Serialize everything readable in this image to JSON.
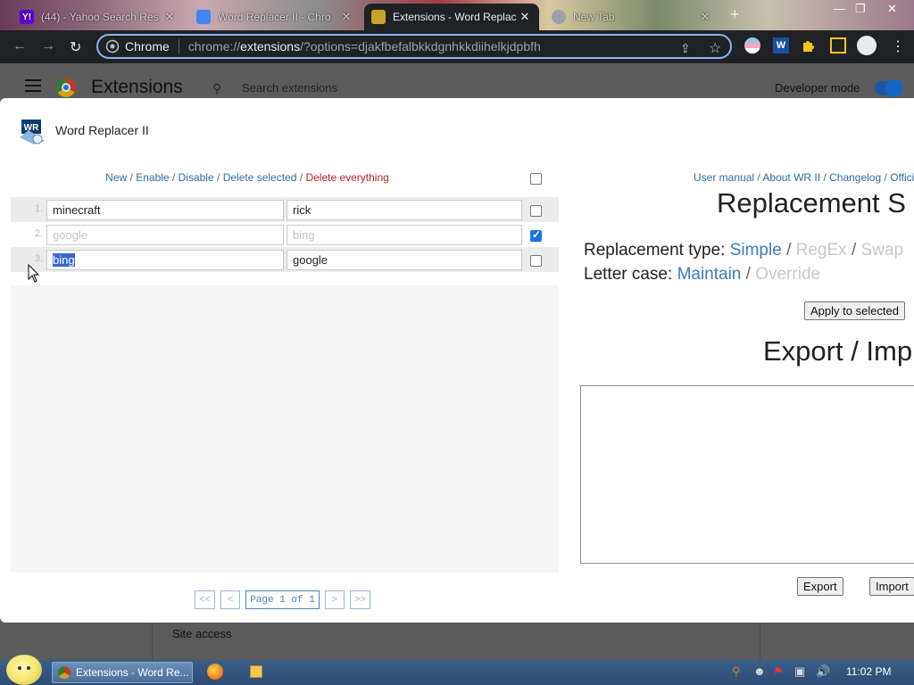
{
  "browser": {
    "tabs": [
      {
        "label": "(44) - Yahoo Search Res",
        "close": "✕",
        "favicon": "Y!",
        "favicon_color": "#6001d2"
      },
      {
        "label": "Word Replacer II - Chro",
        "close": "✕",
        "favicon_color": "#4285f4"
      },
      {
        "label": "Extensions - Word Replac",
        "close": "✕",
        "favicon_color": "#c9a227"
      },
      {
        "label": "New Tab",
        "close": "✕",
        "favicon_color": "#9aa0a6"
      }
    ],
    "new_tab": "+",
    "window_controls": [
      "—",
      "❐",
      "✕"
    ],
    "back": "←",
    "forward": "→",
    "reload": "↻",
    "site_label": "Chrome",
    "url_prefix": "chrome://",
    "url_host": "extensions",
    "url_rest": "/?options=djakfbefalbkkdgnhkkdiihelkjdpbfh",
    "share_icon": "⇪",
    "star_icon": "☆",
    "menu_icon": "⋮"
  },
  "extensions_page": {
    "title": "Extensions",
    "search_placeholder": "Search extensions",
    "developer_mode_label": "Developer mode",
    "developer_mode": true,
    "site_access_label": "Site access"
  },
  "dialog": {
    "logo_text": "WR",
    "title": "Word Replacer II",
    "actions": {
      "new": "New",
      "enable": "Enable",
      "disable": "Disable",
      "delete_selected": "Delete selected",
      "delete_everything": "Delete everything",
      "sep": "/"
    },
    "rows": [
      {
        "num": "1.",
        "find": "minecraft",
        "replace": "rick",
        "checked": false,
        "enabled": true
      },
      {
        "num": "2.",
        "find": "google",
        "replace": "bing",
        "checked": true,
        "enabled": false
      },
      {
        "num": "3.",
        "find": "bing",
        "replace": "google",
        "checked": false,
        "enabled": true
      }
    ],
    "pager": {
      "first": "<<",
      "prev": "<",
      "page_text": "Page 1 of 1",
      "next": ">",
      "last": ">>"
    },
    "links": {
      "manual": "User manual",
      "about": "About WR II",
      "changelog": "Changelog",
      "official": "Offici",
      "sep": "/"
    },
    "settings_heading": "Replacement S",
    "replacement_type": {
      "label": "Replacement type:",
      "simple": "Simple",
      "regex": "RegEx",
      "swap": "Swap",
      "sep": "/"
    },
    "letter_case": {
      "label": "Letter case:",
      "maintain": "Maintain",
      "override": "Override",
      "sep": "/"
    },
    "apply_button": "Apply to selected",
    "export_heading": "Export / Imp",
    "export_button": "Export",
    "import_button": "Import"
  },
  "taskbar": {
    "item_label": "Extensions - Word Re...",
    "clock": "11:02 PM"
  }
}
